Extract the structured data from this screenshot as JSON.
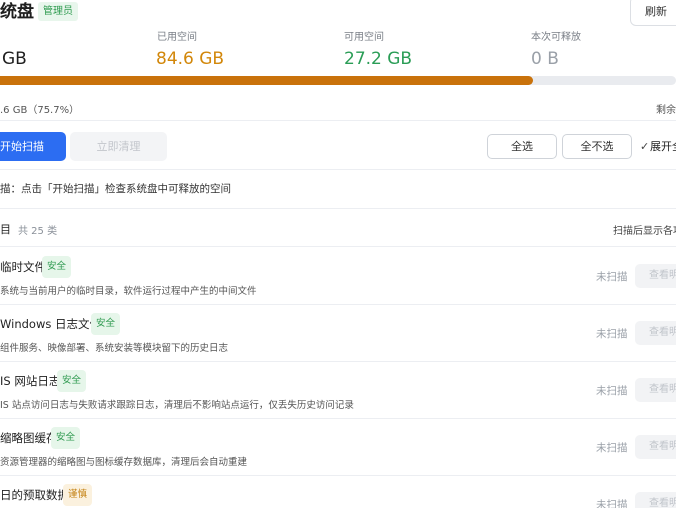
{
  "header": {
    "title": "统盘",
    "role_badge": "管理员",
    "refresh_label": "刷新"
  },
  "stats": {
    "total": {
      "label": "",
      "value": "GB"
    },
    "used": {
      "label": "已用空间",
      "value": "84.6 GB"
    },
    "free": {
      "label": "可用空间",
      "value": "27.2 GB"
    },
    "releasable": {
      "label": "本次可释放",
      "value": "0 B"
    }
  },
  "usage": {
    "fraction": 0.788,
    "text": ".6 GB（75.7%）",
    "remaining_text": "剩余"
  },
  "actions": {
    "start_scan": "开始扫描",
    "clean_now": "立即清理",
    "select_all": "全选",
    "select_none": "全不选",
    "expand_all": "展开全"
  },
  "hint": "描：点击「开始扫描」检查系统盘中可释放的空间",
  "list": {
    "title": "目",
    "count": "共 25 类",
    "note": "扫描后显示各项"
  },
  "items": [
    {
      "name": "临时文件",
      "tag": "安全",
      "tag_type": "safe",
      "desc": "系统与当前用户的临时目录，软件运行过程中产生的中间文件",
      "status": "未扫描",
      "view": "查看明"
    },
    {
      "name": "Windows 日志文件",
      "tag": "安全",
      "tag_type": "safe",
      "desc": "组件服务、映像部署、系统安装等模块留下的历史日志",
      "status": "未扫描",
      "view": "查看明"
    },
    {
      "name": "IS 网站日志",
      "tag": "安全",
      "tag_type": "safe",
      "desc": "IS 站点访问日志与失败请求跟踪日志，清理后不影响站点运行，仅丢失历史访问记录",
      "status": "未扫描",
      "view": "查看明"
    },
    {
      "name": "缩略图缓存",
      "tag": "安全",
      "tag_type": "safe",
      "desc": "资源管理器的缩略图与图标缓存数据库，清理后会自动重建",
      "status": "未扫描",
      "view": "查看明"
    },
    {
      "name": "日的预取数据",
      "tag": "谨慎",
      "tag_type": "care",
      "desc": "",
      "status": "未扫描",
      "view": "查看明"
    }
  ],
  "colors": {
    "primary": "#2c6df2",
    "used": "#c9720b",
    "free": "#2a9d56",
    "safe_tag": "#2f9a50",
    "care_tag": "#c48214"
  }
}
